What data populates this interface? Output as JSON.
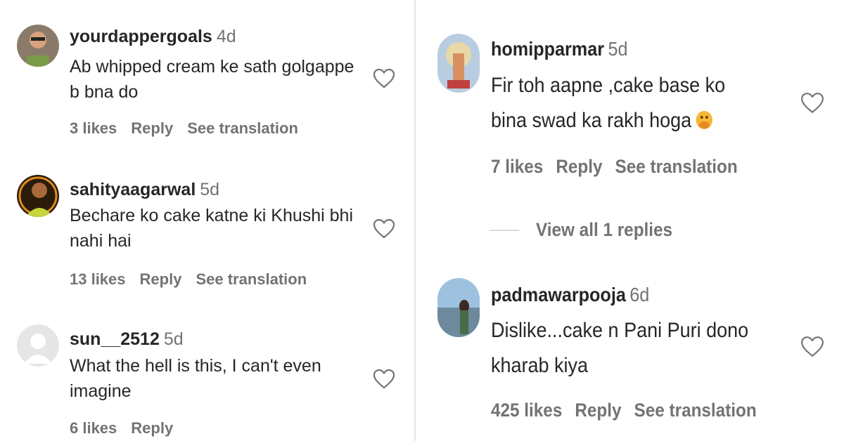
{
  "comments_left": [
    {
      "username": "yourdappergoals",
      "time": "4d",
      "text": "Ab whipped cream ke sath golgappe b bna do",
      "likes": "3 likes",
      "reply": "Reply",
      "translate": "See translation"
    },
    {
      "username": "sahityaagarwal",
      "time": "5d",
      "text": "Bechare ko cake katne ki Khushi bhi nahi hai",
      "likes": "13 likes",
      "reply": "Reply",
      "translate": "See translation"
    },
    {
      "username": "sun__2512",
      "time": "5d",
      "text": "What the hell is this, I can't even imagine",
      "likes": "6 likes",
      "reply": "Reply"
    }
  ],
  "comments_right": [
    {
      "username": "homipparmar",
      "time": "5d",
      "text": "Fir toh aapne ,cake base ko bina swad ka rakh hoga",
      "likes": "7 likes",
      "reply": "Reply",
      "translate": "See translation"
    },
    {
      "username": "padmawarpooja",
      "time": "6d",
      "text": "Dislike...cake n Pani Puri dono kharab kiya",
      "likes": "425 likes",
      "reply": "Reply",
      "translate": "See translation"
    }
  ],
  "view_replies": "View all 1 replies",
  "icons": {
    "like": "heart-outline-icon",
    "emoji": "face-with-hand-over-mouth-emoji"
  },
  "colors": {
    "text": "#262626",
    "secondary": "#737373",
    "divider": "#dbdbdb"
  }
}
